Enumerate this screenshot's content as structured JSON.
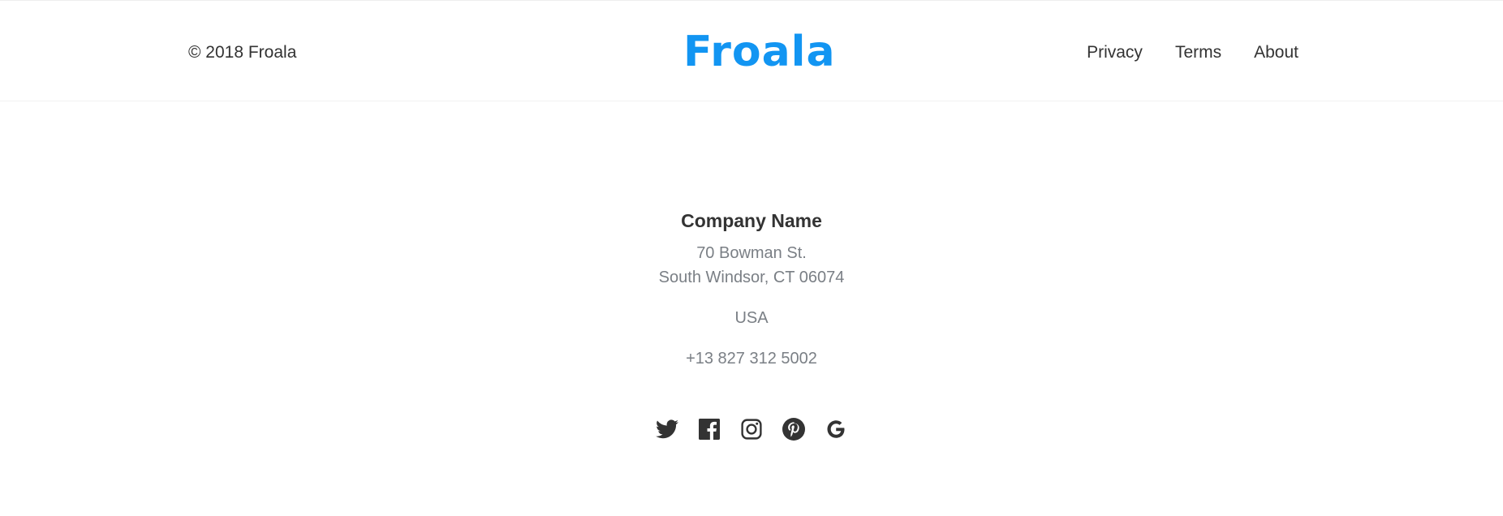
{
  "header": {
    "copyright": "© 2018 Froala",
    "logo_text": "Froala",
    "nav": [
      {
        "label": "Privacy"
      },
      {
        "label": "Terms"
      },
      {
        "label": "About"
      }
    ]
  },
  "contact": {
    "company": "Company Name",
    "address_line1": "70 Bowman St.",
    "address_line2": "South Windsor, CT 06074",
    "country": "USA",
    "phone": "+13 827 312 5002"
  },
  "socials": [
    {
      "icon": "twitter-icon"
    },
    {
      "icon": "facebook-icon"
    },
    {
      "icon": "instagram-icon"
    },
    {
      "icon": "pinterest-icon"
    },
    {
      "icon": "google-icon"
    }
  ],
  "colors": {
    "brand": "#1295f2",
    "text": "#333333",
    "muted": "#7a7f85"
  }
}
